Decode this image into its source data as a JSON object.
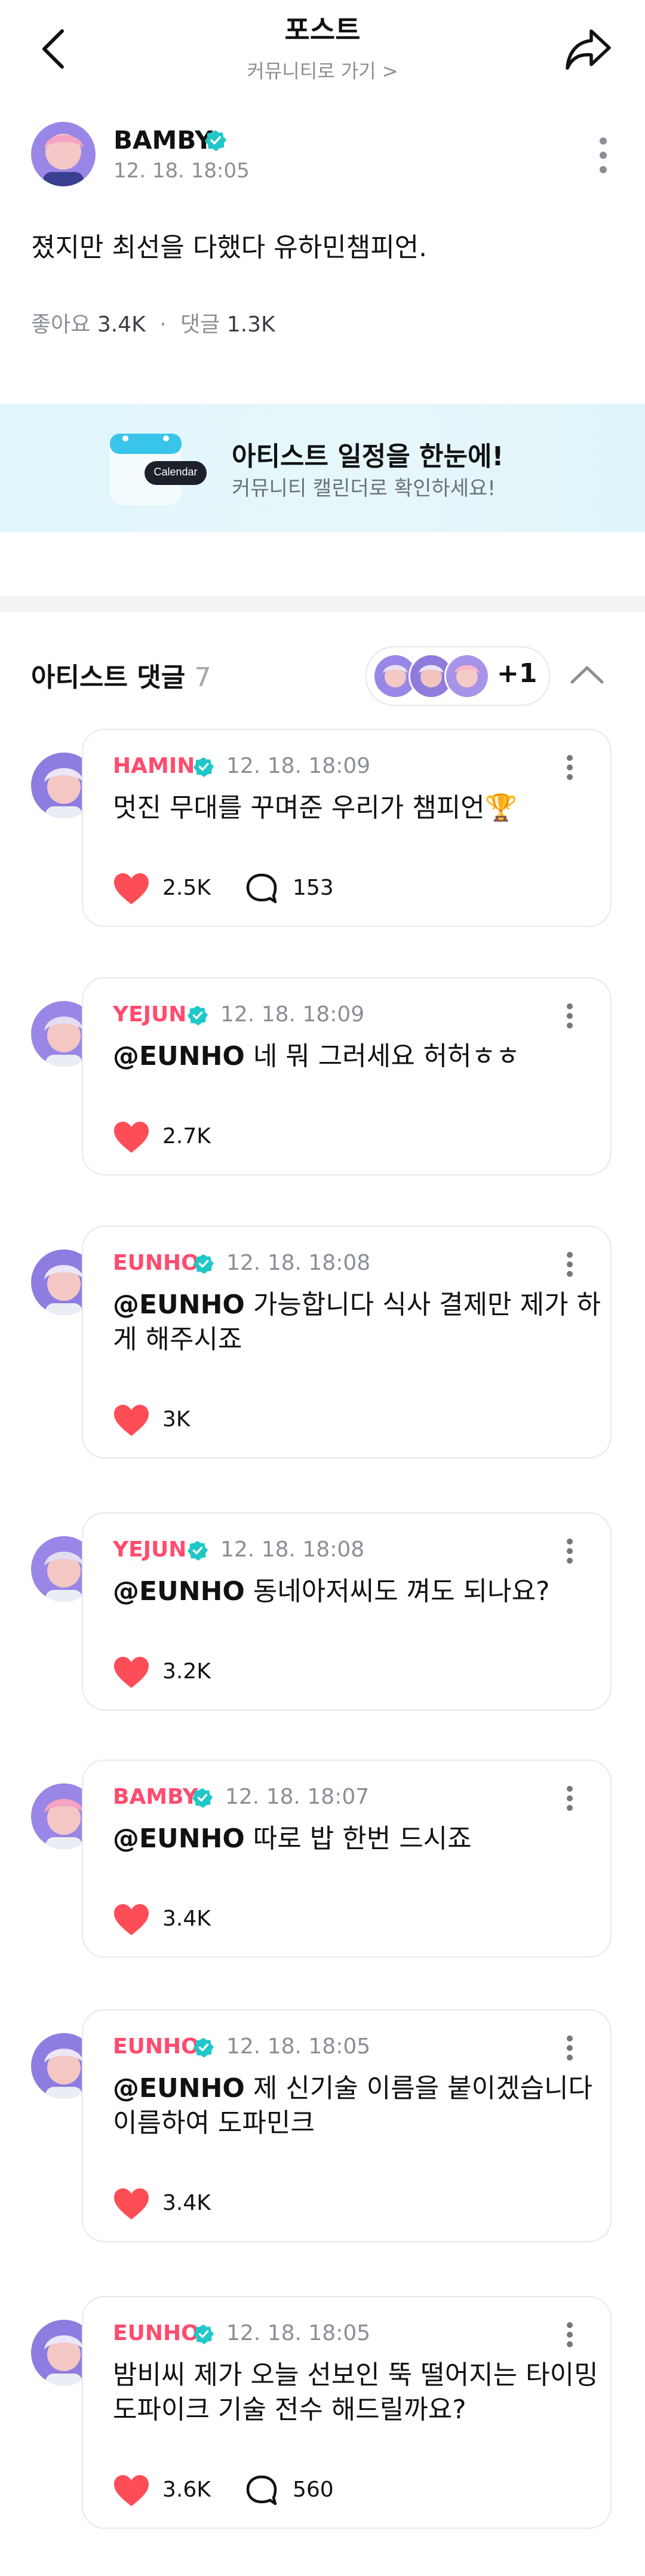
{
  "header": {
    "title": "포스트",
    "subtitle": "커뮤니티로 가기 >",
    "back_icon": "chevron-left-icon",
    "share_icon": "share-icon"
  },
  "post": {
    "author": "BAMBY",
    "time": "12. 18. 18:05",
    "body": "졌지만 최선을 다했다 유하민챔피언.",
    "likes_label": "좋아요",
    "likes": "3.4K",
    "separator": "·",
    "comments_label": "댓글",
    "comments": "1.3K"
  },
  "banner": {
    "title": "아티스트 일정을 한눈에!",
    "subtitle": "커뮤니티 캘린더로 확인하세요!",
    "calendar_label": "Calendar"
  },
  "artist_comments": {
    "title": "아티스트 댓글",
    "count": "7",
    "more_count": "+1",
    "collapse_icon": "chevron-up-icon",
    "items": [
      {
        "name": "HAMIN",
        "time": "12. 18. 18:09",
        "mention": "",
        "text": "멋진 무대를 꾸며준 우리가 챔피언🏆",
        "likes": "2.5K",
        "replies": "153"
      },
      {
        "name": "YEJUN",
        "time": "12. 18. 18:09",
        "mention": "@EUNHO",
        "text": " 네 뭐 그러세요 허허ㅎㅎ",
        "likes": "2.7K",
        "replies": ""
      },
      {
        "name": "EUNHO",
        "time": "12. 18. 18:08",
        "mention": "@EUNHO",
        "text": " 가능합니다 식사 결제만 제가 하게 해주시죠",
        "likes": "3K",
        "replies": ""
      },
      {
        "name": "YEJUN",
        "time": "12. 18. 18:08",
        "mention": "@EUNHO",
        "text": " 동네아저씨도 껴도 되나요?",
        "likes": "3.2K",
        "replies": ""
      },
      {
        "name": "BAMBY",
        "time": "12. 18. 18:07",
        "mention": "@EUNHO",
        "text": " 따로 밥 한번 드시죠",
        "likes": "3.4K",
        "replies": ""
      },
      {
        "name": "EUNHO",
        "time": "12. 18. 18:05",
        "mention": "@EUNHO",
        "text": " 제 신기술 이름을 붙이겠습니다 이름하여 도파민크",
        "likes": "3.4K",
        "replies": ""
      },
      {
        "name": "EUNHO",
        "time": "12. 18. 18:05",
        "mention": "",
        "text": "밤비씨 제가 오늘 선보인 뚝 떨어지는 타이밍 도파이크 기술 전수 해드릴까요?",
        "likes": "3.6K",
        "replies": "560"
      }
    ]
  },
  "colors": {
    "artist_name": "#ff4b6e",
    "verified": "#1fc7c8",
    "heart": "#ff4d57",
    "banner_bg": "#e2f6fb",
    "muted_text": "#8a8f96"
  }
}
